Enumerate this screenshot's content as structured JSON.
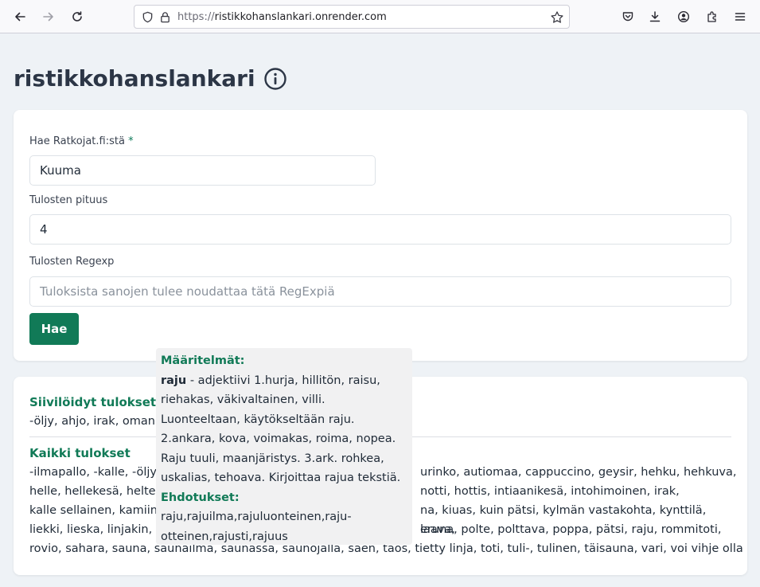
{
  "browser": {
    "url_protocol": "https://",
    "url_host": "ristikkohanslankari.onrender.com"
  },
  "page": {
    "title": "ristikkohanslankari"
  },
  "form": {
    "search_label": "Hae Ratkojat.fi:stä",
    "required_mark": "*",
    "search_value": "Kuuma",
    "length_label": "Tulosten pituus",
    "length_value": "4",
    "regexp_label": "Tulosten Regexp",
    "regexp_placeholder": "Tuloksista sanojen tulee noudattaa tätä RegExpiä",
    "submit_label": "Hae"
  },
  "results": {
    "filtered_title": "Siivilöidyt tulokset",
    "filtered_text": "-öljy, ahjo, irak, oman,",
    "all_title": "Kaikki tulokset",
    "all_lines": [
      "-ilmapallo, -kalle, -öljy,",
      "helle, hellekesä, heltei",
      "kalle sellainen, kamiina",
      "liekki, lieska, linjakin, l",
      "rovio, sahara, sauna, saunailma, saunassa, saunojalla, saen, taos, tietty linja, toti, tuli-, tulinen, täisauna, vari, voi vihje olla"
    ],
    "all_lines_right": [
      "urinko, autiomaa, cappuccino, geysir, hehku, hehkuva,",
      "notti, hottis, intiaanikesä, intohimoinen, irak,",
      "na, kiuas, kuin pätsi, kylmän vastakohta, kynttilä, laava,",
      "eruna, polte, polttava, poppa, pätsi, raju, rommitoti,"
    ]
  },
  "popup": {
    "definitions_title": "Määritelmät:",
    "word": "raju",
    "definition": " - adjektiivi 1.hurja, hillitön, raisu, riehakas, väkivaltainen, villi. Luonteeltaan, käytökseltään raju. 2.ankara, kova, voimakas, roima, nopea. Raju tuuli, maanjäristys. 3.ark. rohkea, uskalias, tehoava. Kirjoittaa rajua tekstiä.",
    "suggestions_title": "Ehdotukset:",
    "suggestions": "raju,rajuilma,rajuluonteinen,raju-otteinen,rajusti,rajuus"
  },
  "colors": {
    "accent": "#117a57",
    "page_bg": "#eef2f6",
    "title": "#2c3646"
  }
}
